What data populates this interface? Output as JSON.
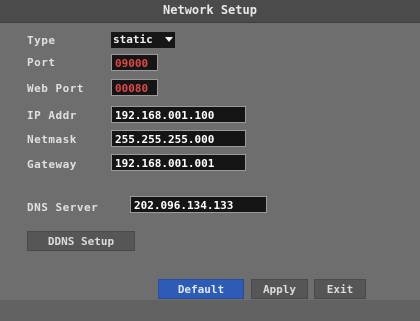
{
  "window": {
    "title": "Network Setup"
  },
  "form": {
    "type": {
      "label": "Type",
      "value": "static"
    },
    "port": {
      "label": "Port",
      "value": "09000"
    },
    "web_port": {
      "label": "Web Port",
      "value": "00080"
    },
    "ip_addr": {
      "label": "IP Addr",
      "value": "192.168.001.100"
    },
    "netmask": {
      "label": "Netmask",
      "value": "255.255.255.000"
    },
    "gateway": {
      "label": "Gateway",
      "value": "192.168.001.001"
    },
    "dns_server": {
      "label": "DNS Server",
      "value": "202.096.134.133"
    }
  },
  "buttons": {
    "ddns_setup": "DDNS Setup",
    "default": "Default",
    "apply": "Apply",
    "exit": "Exit"
  },
  "colors": {
    "background": "#6e6e6e",
    "titlebar": "#4b4b4b",
    "field_bg": "#151515",
    "accent_button": "#2d5bb6",
    "red_text": "#e14848"
  }
}
